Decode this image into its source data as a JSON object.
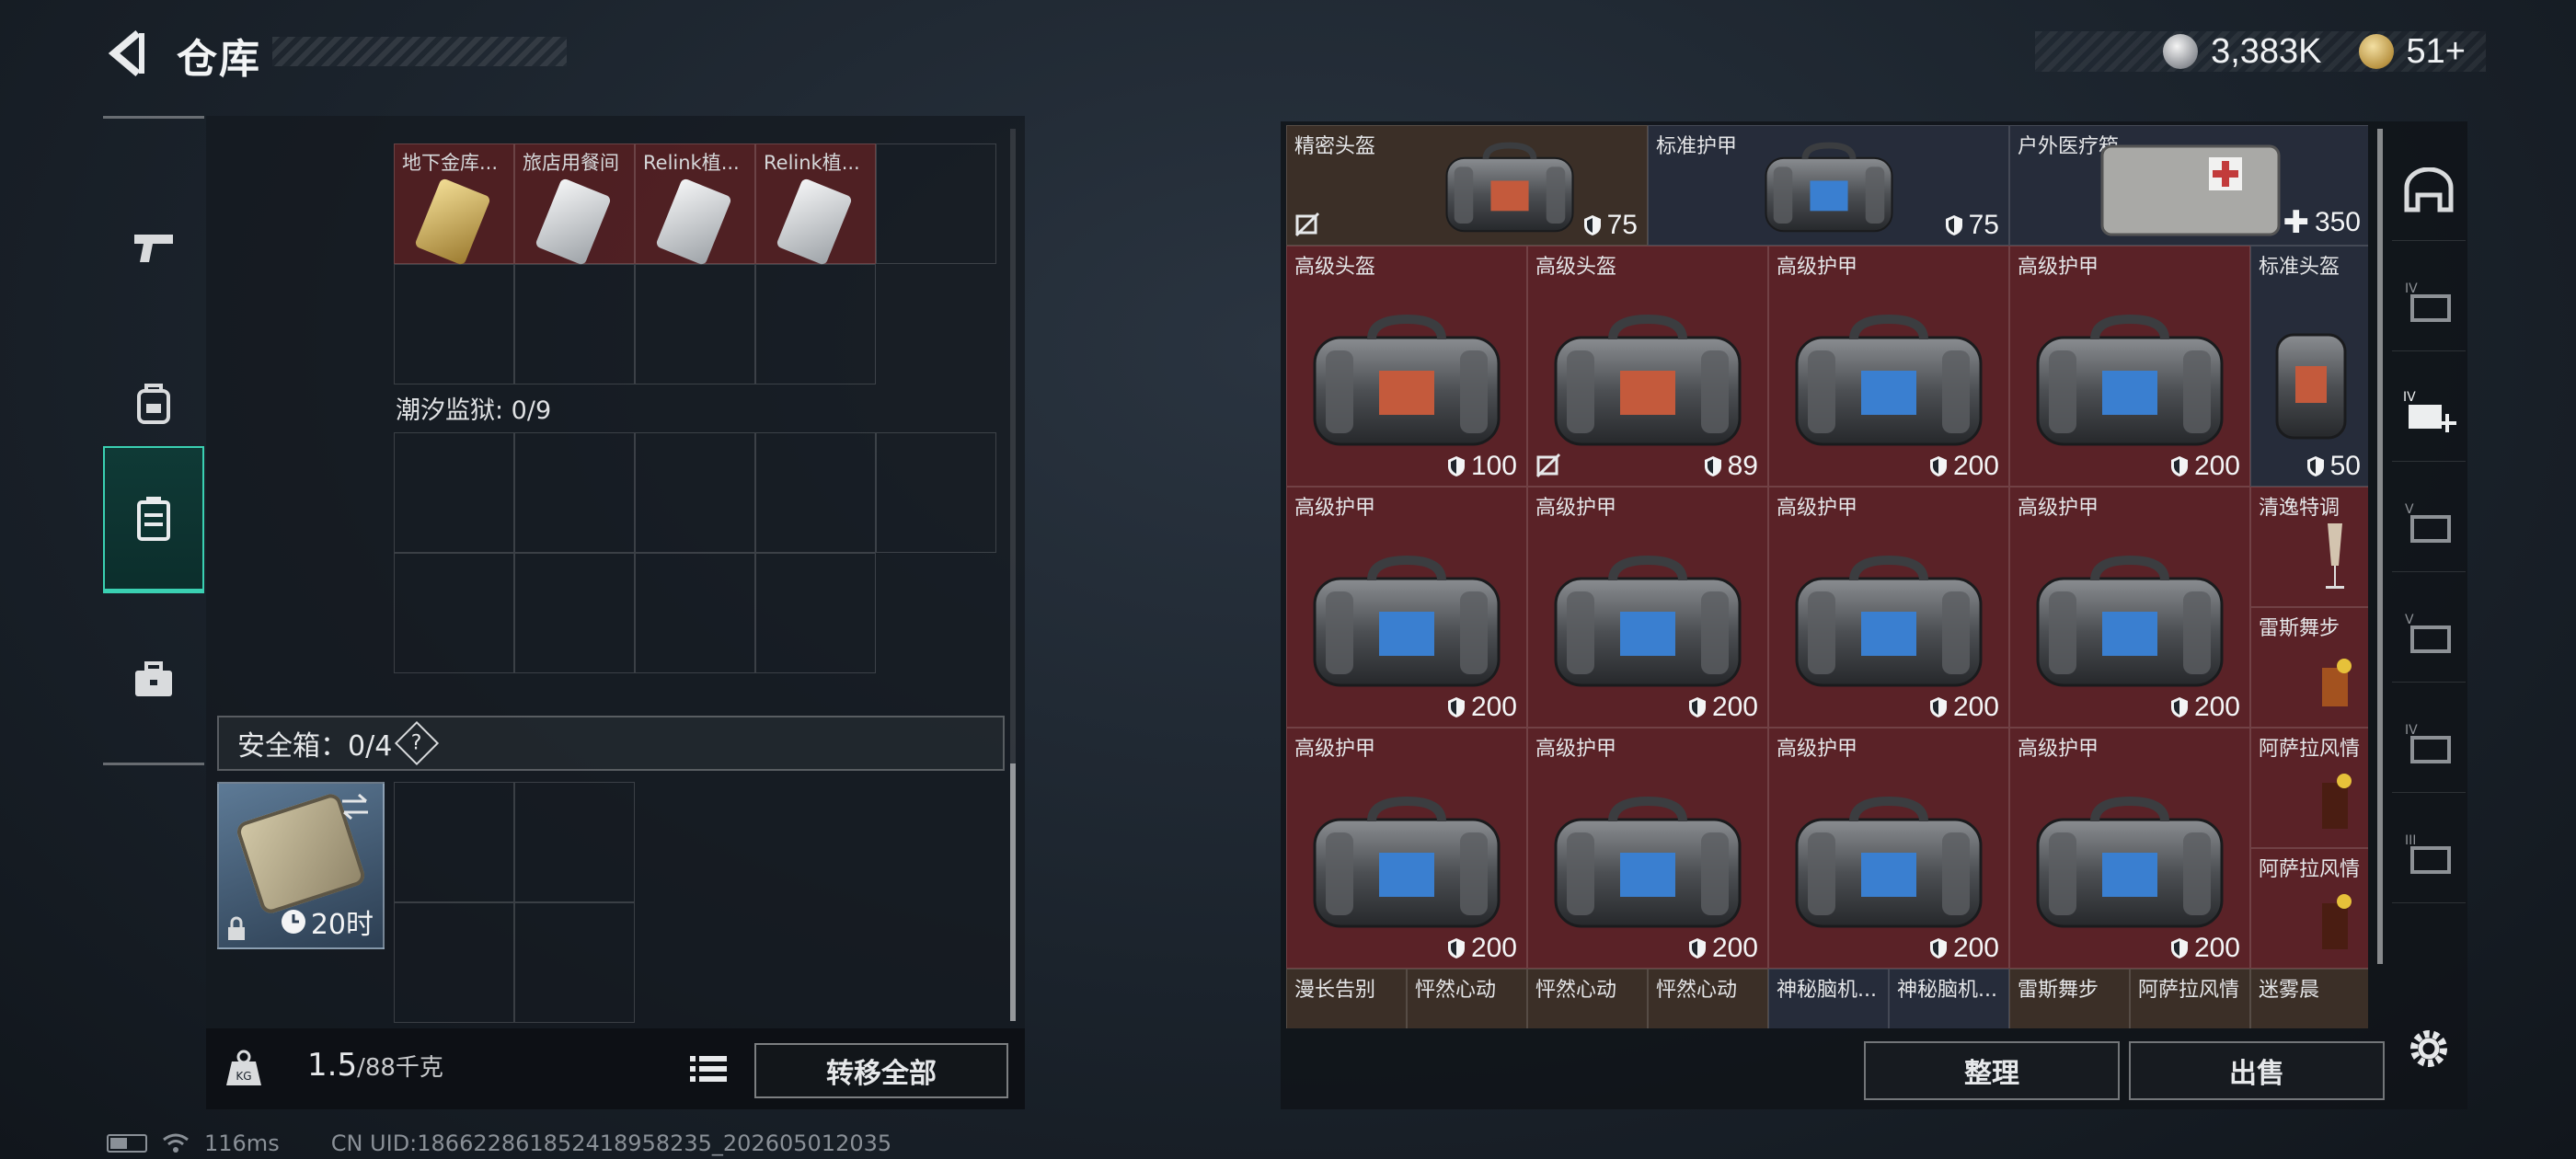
{
  "header": {
    "title": "仓库",
    "currencies": [
      {
        "icon": "silver-coin-icon",
        "value": "3,383K"
      },
      {
        "icon": "gold-coin-icon",
        "value": "51+"
      }
    ]
  },
  "left_tabs": [
    {
      "icon": "pistol-icon",
      "active": false
    },
    {
      "icon": "backpack-icon",
      "active": false
    },
    {
      "icon": "container-icon",
      "active": true
    },
    {
      "icon": "briefcase-icon",
      "active": false
    }
  ],
  "left": {
    "top_section_items": [
      "地下金库...",
      "旅店用餐间",
      "Relink植...",
      "Relink植..."
    ],
    "prison_label": "潮汐监狱: 0/9",
    "safebox_label": "安全箱：0/4",
    "safebox_help": "?",
    "safe_item_time": "20时",
    "weight_value": "1.5",
    "weight_max": "/88千克",
    "transfer_all": "转移全部"
  },
  "grid": {
    "row1": [
      {
        "name": "精密头盔",
        "value": "75",
        "kind": "shield"
      },
      {
        "name": "标准护甲",
        "value": "75",
        "kind": "shield"
      },
      {
        "name": "户外医疗箱",
        "value": "350",
        "kind": "plus"
      }
    ],
    "row2": [
      {
        "name": "高级头盔",
        "value": "100"
      },
      {
        "name": "高级头盔",
        "value": "89"
      },
      {
        "name": "高级护甲",
        "value": "200"
      },
      {
        "name": "高级护甲",
        "value": "200"
      },
      {
        "name": "标准头盔",
        "value": "50"
      }
    ],
    "row3": [
      {
        "name": "高级护甲",
        "value": "200"
      },
      {
        "name": "高级护甲",
        "value": "200"
      },
      {
        "name": "高级护甲",
        "value": "200"
      },
      {
        "name": "高级护甲",
        "value": "200"
      }
    ],
    "row3_side": [
      "清逸特调",
      "雷斯舞步"
    ],
    "row4": [
      {
        "name": "高级护甲",
        "value": "200"
      },
      {
        "name": "高级护甲",
        "value": "200"
      },
      {
        "name": "高级护甲",
        "value": "200"
      },
      {
        "name": "高级护甲",
        "value": "200"
      }
    ],
    "row4_side": [
      "阿萨拉风情",
      "阿萨拉风情"
    ],
    "row5": [
      "漫长告别",
      "怦然心动",
      "怦然心动",
      "怦然心动",
      "神秘脑机...",
      "神秘脑机...",
      "雷斯舞步",
      "阿萨拉风情",
      "迷雾晨"
    ]
  },
  "actions": {
    "sort": "整理",
    "sell": "出售"
  },
  "right_side_icons": [
    "bunker-icon",
    "stash-iv-icon",
    "stash-iv-add-icon",
    "stash-v-icon",
    "stash-v-icon",
    "stash-iv-icon",
    "stash-iii-icon"
  ],
  "status": {
    "ping": "116ms",
    "uid": "CN UID:186622861852418958235_202605012035"
  }
}
